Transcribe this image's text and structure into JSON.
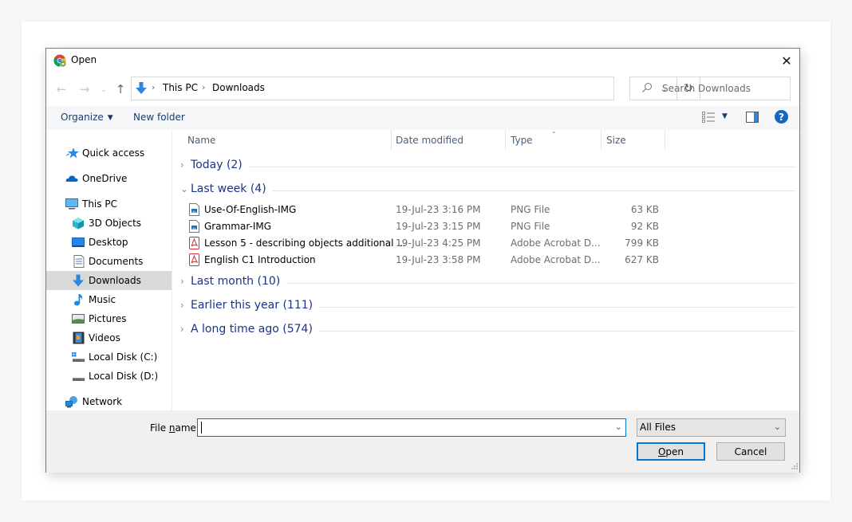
{
  "window": {
    "title": "Open",
    "app_icon": "chrome-icon",
    "close_label": "✕"
  },
  "navigation": {
    "back_icon": "←",
    "forward_icon": "→",
    "recent_icon": "⌄",
    "up_icon": "↑",
    "breadcrumb": [
      "This PC",
      "Downloads"
    ],
    "breadcrumb_sep": "›",
    "dropdown_icon": "⌄",
    "refresh_icon": "↻",
    "search_placeholder": "Search Downloads"
  },
  "commandbar": {
    "organize_label": "Organize",
    "organize_caret": "▼",
    "new_folder_label": "New folder",
    "view_caret": "▼",
    "help_label": "?"
  },
  "sidebar": {
    "items": [
      {
        "label": "Quick access",
        "icon": "star-icon"
      },
      {
        "label": "OneDrive",
        "icon": "cloud-icon"
      },
      {
        "label": "This PC",
        "icon": "computer-icon"
      },
      {
        "label": "3D Objects",
        "icon": "cube-icon"
      },
      {
        "label": "Desktop",
        "icon": "desktop-icon"
      },
      {
        "label": "Documents",
        "icon": "document-icon"
      },
      {
        "label": "Downloads",
        "icon": "download-icon",
        "selected": true
      },
      {
        "label": "Music",
        "icon": "music-icon"
      },
      {
        "label": "Pictures",
        "icon": "pictures-icon"
      },
      {
        "label": "Videos",
        "icon": "videos-icon"
      },
      {
        "label": "Local Disk (C:)",
        "icon": "drive-c-icon"
      },
      {
        "label": "Local Disk (D:)",
        "icon": "drive-d-icon"
      },
      {
        "label": "Network",
        "icon": "network-icon"
      }
    ]
  },
  "filelist": {
    "columns": [
      "Name",
      "Date modified",
      "Type",
      "Size"
    ],
    "sort_indicator": "⌄",
    "groups": [
      {
        "label": "Today (2)",
        "expanded": false,
        "chevron": "›"
      },
      {
        "label": "Last week (4)",
        "expanded": true,
        "chevron": "⌄"
      },
      {
        "label": "Last month (10)",
        "expanded": false,
        "chevron": "›"
      },
      {
        "label": "Earlier this year (111)",
        "expanded": false,
        "chevron": "›"
      },
      {
        "label": "A long time ago (574)",
        "expanded": false,
        "chevron": "›"
      }
    ],
    "files": [
      {
        "name": "Use-Of-English-IMG",
        "date": "19-Jul-23 3:16 PM",
        "type": "PNG File",
        "size": "63 KB",
        "kind": "image"
      },
      {
        "name": "Grammar-IMG",
        "date": "19-Jul-23 3:15 PM",
        "type": "PNG File",
        "size": "92 KB",
        "kind": "image"
      },
      {
        "name": "Lesson 5 - describing objects additional ...",
        "date": "19-Jul-23 4:25 PM",
        "type": "Adobe Acrobat D...",
        "size": "799 KB",
        "kind": "pdf"
      },
      {
        "name": "English C1 Introduction",
        "date": "19-Jul-23 3:58 PM",
        "type": "Adobe Acrobat D...",
        "size": "627 KB",
        "kind": "pdf"
      }
    ]
  },
  "footer": {
    "filename_label_pre": "File ",
    "filename_label_accel": "n",
    "filename_label_post": "ame:",
    "filename_value": "",
    "dropdown_icon": "⌄",
    "filter_value": "All Files",
    "open_accel": "O",
    "open_rest": "pen",
    "cancel_label": "Cancel"
  },
  "colors": {
    "accent": "#0078d7",
    "group_text": "#1e3287",
    "selected_bg": "#d9d9d9",
    "help_blue": "#1666c1"
  }
}
